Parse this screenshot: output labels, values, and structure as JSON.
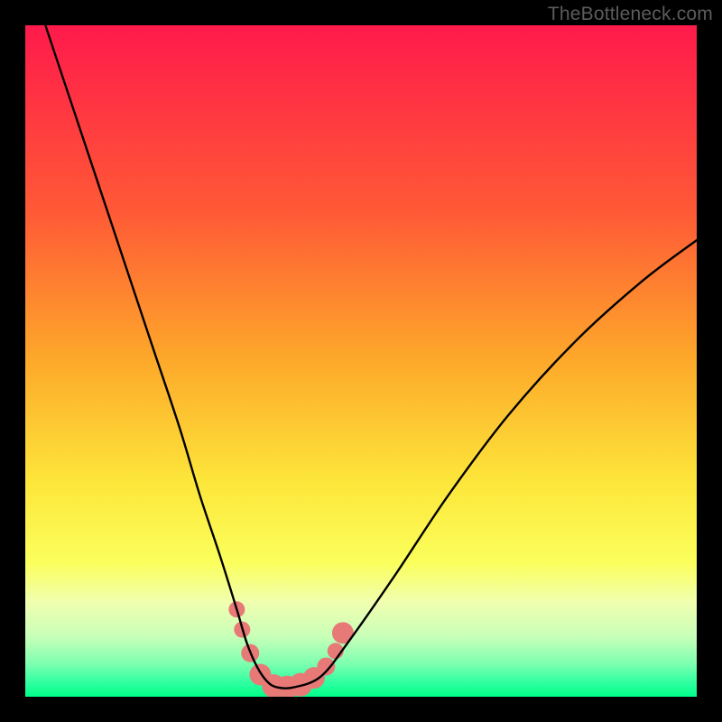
{
  "watermark": "TheBottleneck.com",
  "chart_data": {
    "type": "line",
    "title": "",
    "xlabel": "",
    "ylabel": "",
    "xlim": [
      0,
      100
    ],
    "ylim": [
      0,
      100
    ],
    "gradient_stops": [
      {
        "offset": 0,
        "color": "#ff1a4b"
      },
      {
        "offset": 28,
        "color": "#ff5a36"
      },
      {
        "offset": 50,
        "color": "#fda92a"
      },
      {
        "offset": 68,
        "color": "#fde63a"
      },
      {
        "offset": 80,
        "color": "#fbff5c"
      },
      {
        "offset": 86,
        "color": "#f0ffb0"
      },
      {
        "offset": 91,
        "color": "#c8ffb8"
      },
      {
        "offset": 95,
        "color": "#7fffb0"
      },
      {
        "offset": 98,
        "color": "#2dffa0"
      },
      {
        "offset": 100,
        "color": "#00ff8a"
      }
    ],
    "series": [
      {
        "name": "bottleneck-curve",
        "x": [
          3,
          7,
          11,
          15,
          19,
          23,
          26,
          29,
          31.5,
          33,
          34.5,
          36,
          37.5,
          40,
          44,
          48,
          55,
          63,
          72,
          82,
          92,
          100
        ],
        "y": [
          100,
          88,
          76,
          64,
          52,
          40,
          30,
          21,
          13,
          8,
          4.5,
          2.3,
          1.4,
          1.4,
          3,
          8,
          18,
          30,
          42,
          53,
          62,
          68
        ]
      }
    ],
    "markers": {
      "name": "highlight-band",
      "color": "#e77a77",
      "points": [
        {
          "x": 31.5,
          "y": 13,
          "r": 9
        },
        {
          "x": 32.3,
          "y": 10,
          "r": 9
        },
        {
          "x": 33.5,
          "y": 6.5,
          "r": 10
        },
        {
          "x": 35.0,
          "y": 3.3,
          "r": 12
        },
        {
          "x": 37.0,
          "y": 1.6,
          "r": 13
        },
        {
          "x": 39.0,
          "y": 1.4,
          "r": 13
        },
        {
          "x": 41.0,
          "y": 1.8,
          "r": 13
        },
        {
          "x": 43.0,
          "y": 2.8,
          "r": 12
        },
        {
          "x": 44.8,
          "y": 4.5,
          "r": 10
        },
        {
          "x": 46.2,
          "y": 6.8,
          "r": 9
        },
        {
          "x": 47.3,
          "y": 9.5,
          "r": 12
        }
      ]
    }
  }
}
